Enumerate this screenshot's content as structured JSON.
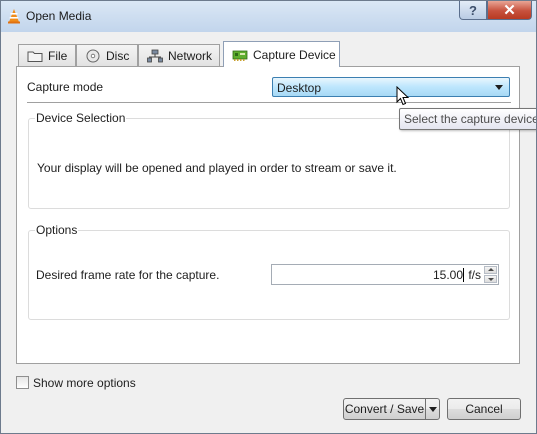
{
  "window": {
    "title": "Open Media",
    "help_label": "?",
    "close_label": "✕"
  },
  "tabs": [
    {
      "label": "File",
      "icon": "folder-icon"
    },
    {
      "label": "Disc",
      "icon": "disc-icon"
    },
    {
      "label": "Network",
      "icon": "network-icon"
    },
    {
      "label": "Capture Device",
      "icon": "capture-card-icon",
      "active": true
    }
  ],
  "capture": {
    "mode_label": "Capture mode",
    "mode_value": "Desktop",
    "device_group_title": "Device Selection",
    "device_message": "Your display will be opened and played in order to stream or save it.",
    "options_group_title": "Options",
    "frame_rate_label": "Desired frame rate for the capture.",
    "frame_rate_value": "15.00",
    "frame_rate_suffix": "f/s"
  },
  "tooltip": {
    "text": "Select the capture device"
  },
  "footer": {
    "show_more_label": "Show more options",
    "show_more_checked": false,
    "convert_label": "Convert / Save",
    "cancel_label": "Cancel"
  },
  "colors": {
    "titlebar": "#cfdff1",
    "combo_highlight": "#bde6fd",
    "close_button": "#c7513d"
  }
}
